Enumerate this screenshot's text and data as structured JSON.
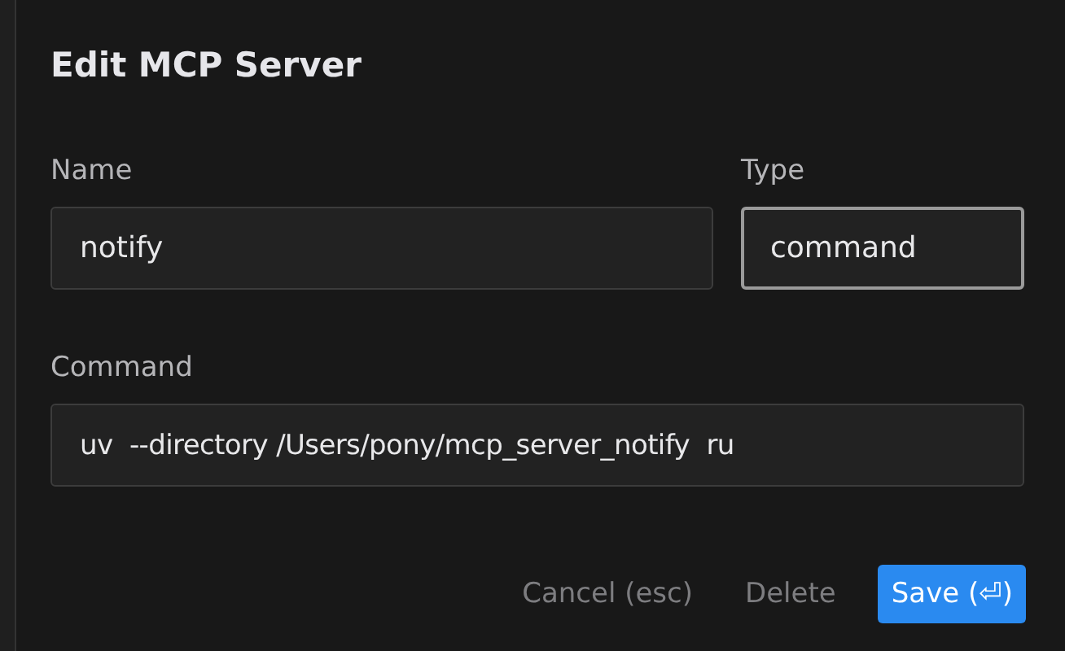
{
  "dialog": {
    "title": "Edit MCP Server",
    "fields": [
      {
        "label": "Name",
        "value": "notify",
        "focused": false
      },
      {
        "label": "Type",
        "value": "command",
        "focused": true
      }
    ],
    "command": {
      "label": "Command",
      "value": "uv  --directory /Users/pony/mcp_server_notify  ru",
      "focused": false
    },
    "buttons": [
      {
        "label": "Cancel (esc)",
        "kind": "secondary"
      },
      {
        "label": "Delete",
        "kind": "secondary"
      },
      {
        "label": "Save (⏎)",
        "kind": "primary"
      }
    ]
  }
}
